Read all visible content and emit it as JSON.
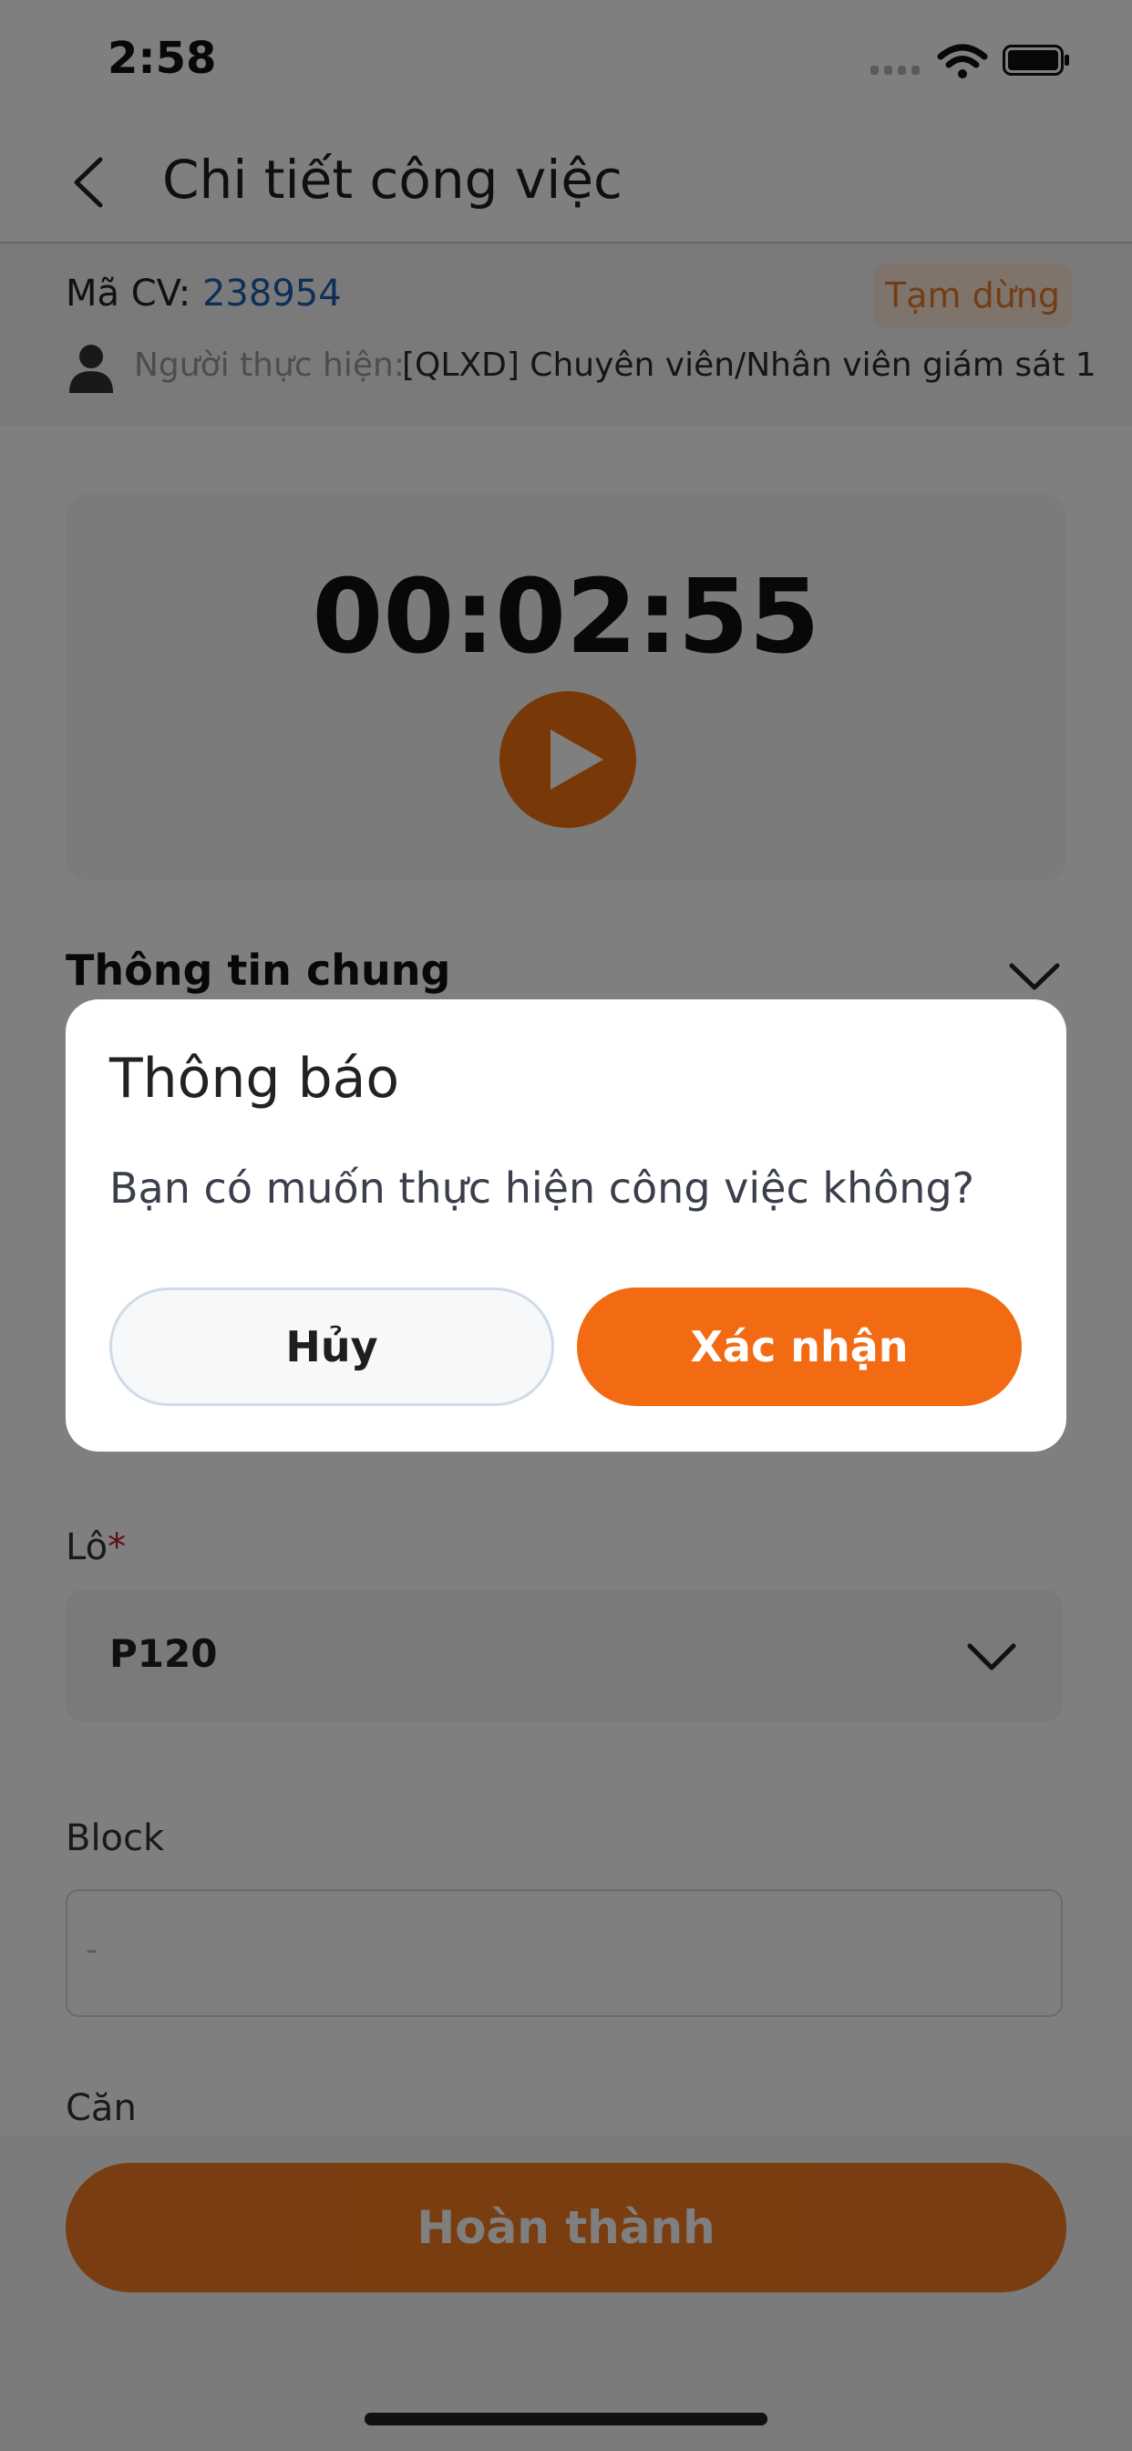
{
  "status_bar": {
    "time": "2:58"
  },
  "header": {
    "title": "Chi tiết công việc"
  },
  "info": {
    "code_label": "Mã CV:",
    "code_value": "238954",
    "status_badge": "Tạm dừng",
    "performer_label": "Người thực hiện:",
    "performer_value": "[QLXD] Chuyên viên/Nhân viên giám sát 1"
  },
  "timer": {
    "value": "00:02:55"
  },
  "section": {
    "general_info": "Thông tin chung"
  },
  "form": {
    "lot_label": "Lô",
    "lot_required": "*",
    "lot_value": "P120",
    "block_label": "Block",
    "block_placeholder": "-",
    "can_label": "Căn"
  },
  "bottom": {
    "complete_button": "Hoàn thành"
  },
  "dialog": {
    "title": "Thông báo",
    "message": "Bạn có muốn thực hiện công việc không?",
    "cancel": "Hủy",
    "confirm": "Xác nhận"
  },
  "colors": {
    "accent": "#f26b12",
    "link": "#1d5fae",
    "badge_bg": "#fde9d7",
    "badge_text": "#e47a2e",
    "required": "#c0182c"
  },
  "icons": [
    "chevron-left-icon",
    "user-icon",
    "play-icon",
    "chevron-down-icon",
    "wifi-icon",
    "battery-icon",
    "cellular-signal-icon"
  ]
}
